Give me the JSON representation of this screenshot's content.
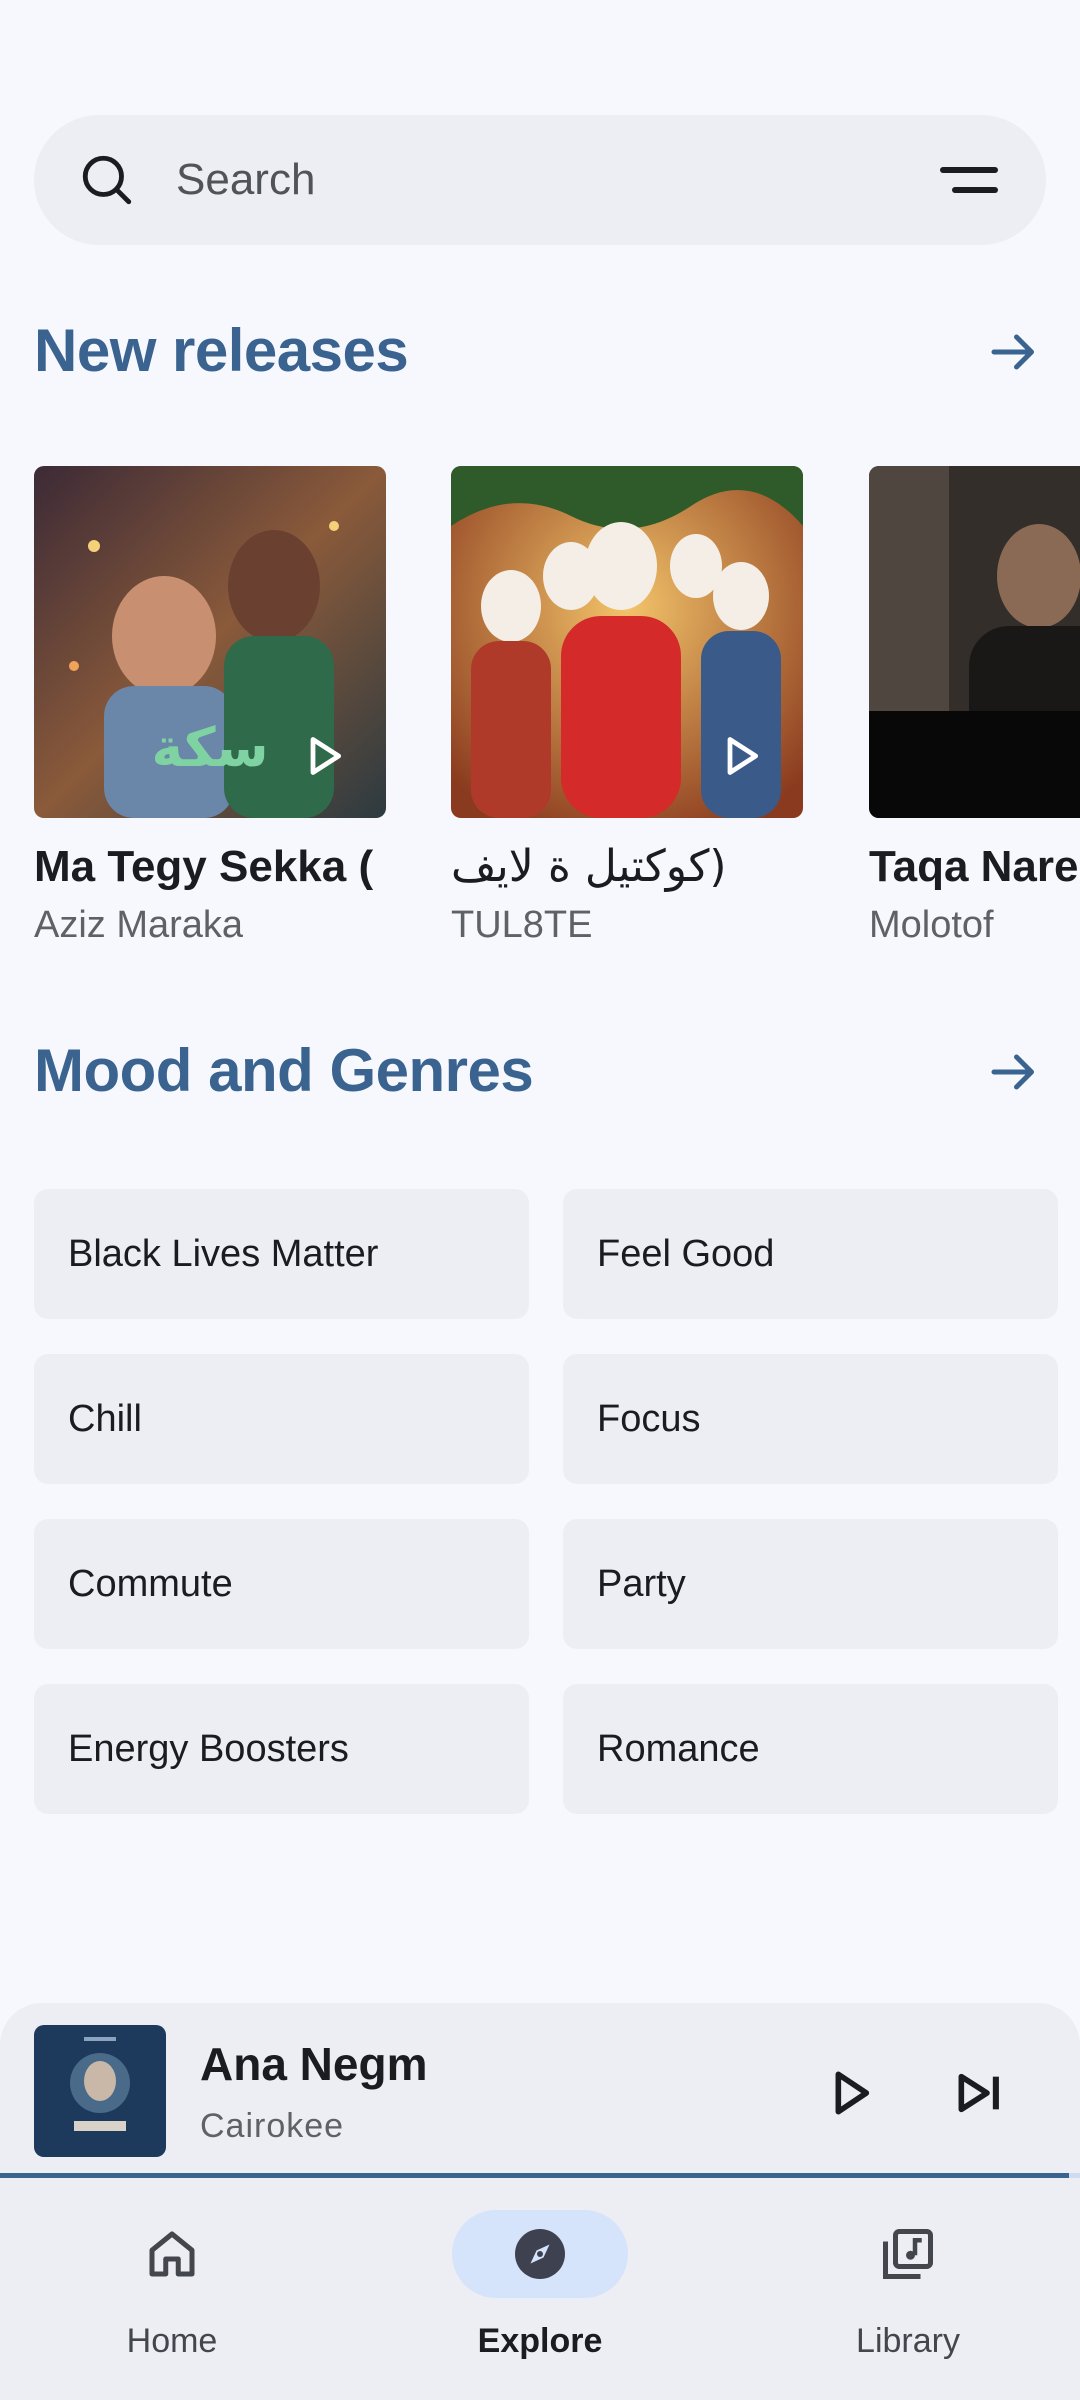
{
  "search": {
    "placeholder": "Search"
  },
  "new_releases": {
    "title": "New releases",
    "albums": [
      {
        "title": "Ma Tegy Sekka (",
        "artist": "Aziz Maraka"
      },
      {
        "title": "كوكتيل ة لايف)",
        "artist": "TUL8TE"
      },
      {
        "title": "Taqa Nare",
        "artist": "Molotof"
      }
    ]
  },
  "moods": {
    "title": "Mood and Genres",
    "items": [
      "Black Lives Matter",
      "Feel Good",
      "Chill",
      "Focus",
      "Commute",
      "Party",
      "Energy Boosters",
      "Romance"
    ]
  },
  "player": {
    "title": "Ana Negm",
    "artist": "Cairokee",
    "progress": 0.99
  },
  "nav": {
    "home": "Home",
    "explore": "Explore",
    "library": "Library"
  },
  "colors": {
    "accent": "#3a6390",
    "background": "#f7f8fd",
    "surface": "#eceef3",
    "active_pill": "#d5e3fb"
  }
}
